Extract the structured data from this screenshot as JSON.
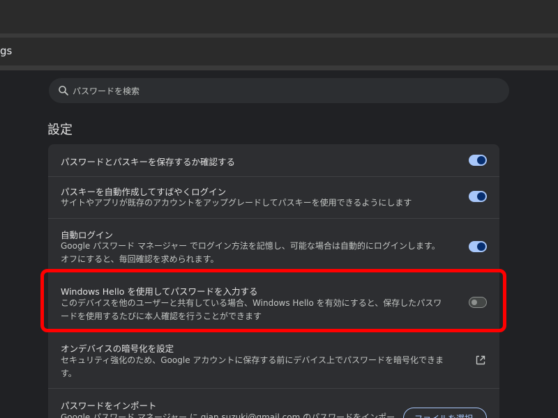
{
  "address_bar": {
    "url_text": "gs"
  },
  "search": {
    "placeholder": "パスワードを検索",
    "icon": "search-icon"
  },
  "section": {
    "title": "設定"
  },
  "settings": {
    "save_prompt": {
      "title": "パスワードとパスキーを保存するか確認する",
      "enabled": true
    },
    "auto_passkey": {
      "title": "パスキーを自動作成してすばやくログイン",
      "description": "サイトやアプリが既存のアカウントをアップグレードしてパスキーを使用できるようにします",
      "enabled": true
    },
    "auto_login": {
      "title": "自動ログイン",
      "description_line1": "Google パスワード マネージャー でログイン方法を記憶し、可能な場合は自動的にログインします。",
      "description_line2": "オフにすると、毎回確認を求められます。",
      "enabled": true
    },
    "windows_hello": {
      "title": "Windows Hello を使用してパスワードを入力する",
      "description_line1": "このデバイスを他のユーザーと共有している場合、Windows Hello を有効にすると、保存したパスワ",
      "description_line2": "ードを使用するたびに本人確認を行うことができます",
      "enabled": false
    },
    "on_device_encryption": {
      "title": "オンデバイスの暗号化を設定",
      "description_line1": "セキュリティ強化のため、Google アカウントに保存する前にデバイス上でパスワードを暗号化できま",
      "description_line2": "す。",
      "icon": "external-link-icon"
    },
    "import": {
      "title": "パスワードをインポート",
      "description": "Google パスワード マネージャー に qian.suzuki@gmail.com のパスワードをインポー",
      "button_label": "ファイルを選択"
    }
  },
  "colors": {
    "accent": "#a8c7fa",
    "highlight": "#ff0000",
    "background": "#202124",
    "card": "#2d2e31"
  }
}
